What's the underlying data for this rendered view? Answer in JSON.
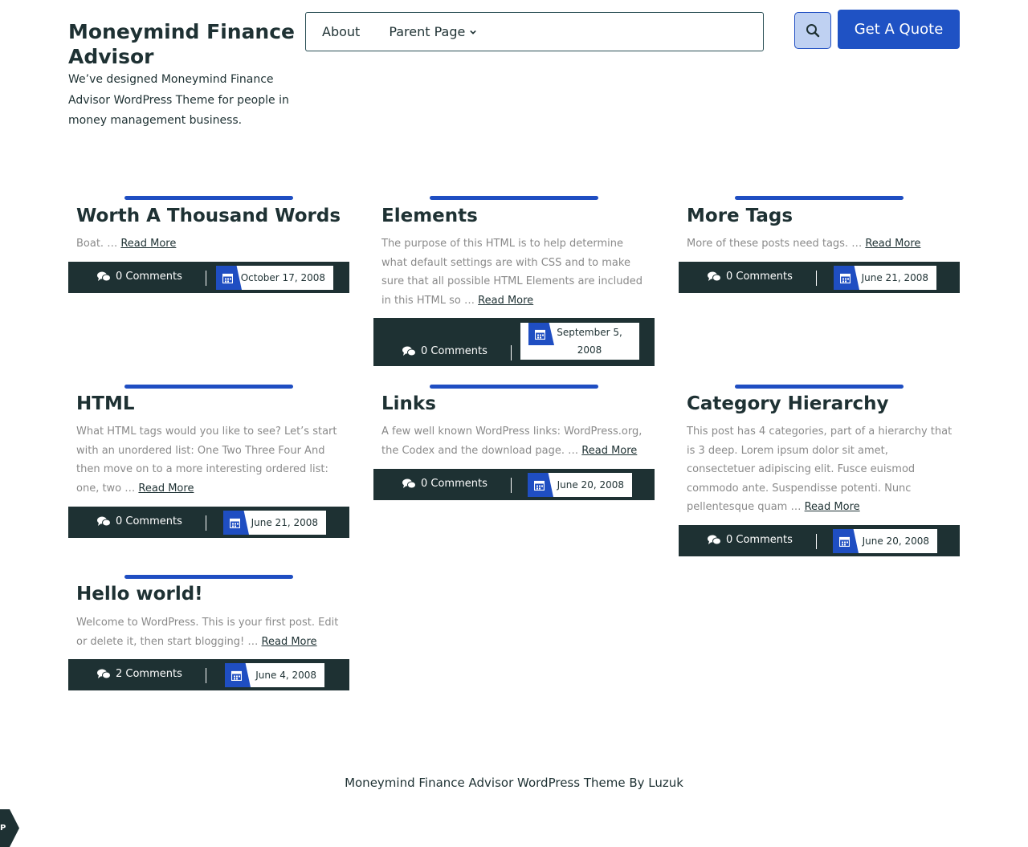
{
  "site": {
    "title": "Moneymind Finance Advisor",
    "description": "We’ve designed Moneymind Finance Advisor WordPress Theme for people in money management business."
  },
  "nav": {
    "items": [
      {
        "label": "About"
      },
      {
        "label": "Parent Page"
      }
    ],
    "quote_label": "Get A Quote"
  },
  "colors": {
    "accent": "#1f4ec2",
    "dark": "#1e3133",
    "muted_text": "#8a8a8a"
  },
  "posts": [
    {
      "title": "Worth A Thousand Words",
      "excerpt": "Boat. …",
      "read_more": "Read More",
      "comments": "0 Comments",
      "date": "October 17, 2008"
    },
    {
      "title": "Elements",
      "excerpt": "The purpose of this HTML is to help determine what default settings are with CSS and to make sure that all possible HTML Elements are included in this HTML so …",
      "read_more": "Read More",
      "comments": "0 Comments",
      "date": "September 5, 2008"
    },
    {
      "title": "More Tags",
      "excerpt": "More of these posts need tags. …",
      "read_more": "Read More",
      "comments": "0 Comments",
      "date": "June 21, 2008"
    },
    {
      "title": "HTML",
      "excerpt": "What HTML tags would you like to see? Let’s start with an unordered list: One Two Three Four And then move on to a more interesting ordered list: one, two …",
      "read_more": "Read More",
      "comments": "0 Comments",
      "date": "June 21, 2008"
    },
    {
      "title": "Links",
      "excerpt": "A few well known WordPress links: WordPress.org, the Codex and the download page. …",
      "read_more": "Read More",
      "comments": "0 Comments",
      "date": "June 20, 2008"
    },
    {
      "title": "Category Hierarchy",
      "excerpt": "This post has 4 categories, part of a hierarchy that is 3 deep. Lorem ipsum dolor sit amet, consectetuer adipiscing elit. Fusce euismod commodo ante. Suspendisse potenti. Nunc pellentesque quam …",
      "read_more": "Read More",
      "comments": "0 Comments",
      "date": "June 20, 2008"
    },
    {
      "title": "Hello world!",
      "excerpt": "Welcome to WordPress. This is your first post. Edit or delete it, then start blogging! …",
      "read_more": "Read More",
      "comments": "2 Comments",
      "date": "June 4, 2008"
    }
  ],
  "footer": {
    "credit": "Moneymind Finance Advisor WordPress Theme By Luzuk"
  },
  "corner": {
    "label": "P"
  }
}
